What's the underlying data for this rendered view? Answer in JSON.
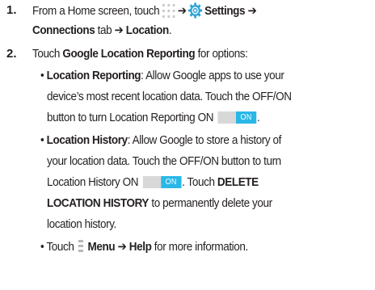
{
  "steps": [
    {
      "number": "1.",
      "lines": {
        "l1": {
          "pre": "From a Home screen, touch",
          "arrow1": "➔",
          "settings": "Settings",
          "arrow2": "➔"
        },
        "l2": {
          "connections": "Connections",
          "tab": " tab ",
          "arrow": "➔",
          "location": " Location",
          "end": "."
        }
      },
      "icons": [
        "apps-icon",
        "settings-gear-icon"
      ]
    },
    {
      "number": "2.",
      "lead": {
        "pre": "Touch ",
        "bold": "Google Location Reporting",
        "post": " for options:"
      },
      "bullets": [
        {
          "title": "Location Reporting",
          "l1_post": ": Allow Google apps to use your",
          "l2": "device’s most recent location data. Touch the OFF/ON",
          "l3_pre": "button to turn Location Reporting ON",
          "l3_post": "."
        },
        {
          "title": "Location History",
          "l1_post": ": Allow Google to store a history of",
          "l2": "your location data. Touch the OFF/ON button to turn",
          "l3_pre": "Location History ON",
          "l3_mid": ". Touch ",
          "l3_bold": "DELETE",
          "l4_bold": "LOCATION HISTORY",
          "l4_post": " to permanently delete your",
          "l5": "location history."
        },
        {
          "pre": "Touch",
          "menu": "Menu",
          "arrow": "➔",
          "help": "Help",
          "post": " for more information."
        }
      ]
    }
  ],
  "bullet_char": "•",
  "toggle_label": "ON",
  "colors": {
    "text": "#231f20",
    "toggle_on": "#29b7e8",
    "toggle_track": "#d8d8d8",
    "icon_gray": "#c9c9c9"
  }
}
